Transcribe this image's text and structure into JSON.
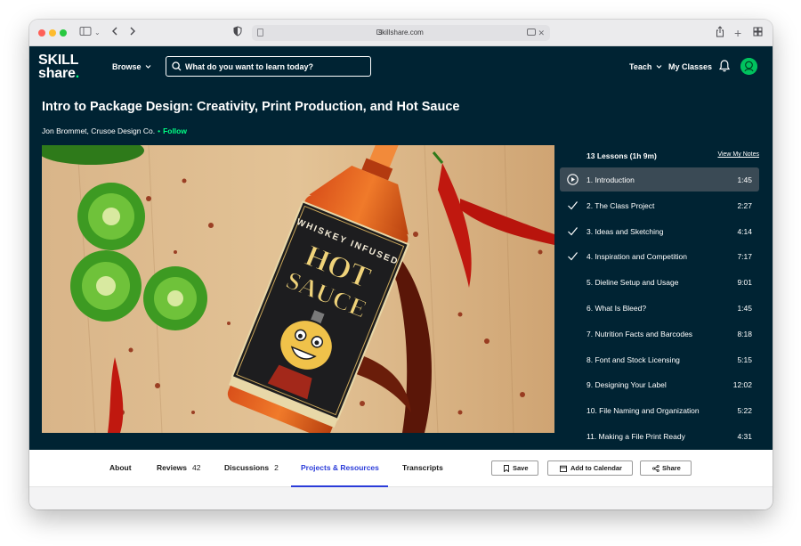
{
  "browser": {
    "url": "skillshare.com"
  },
  "header": {
    "logo_line1": "SKILL",
    "logo_line2": "share",
    "logo_dot": ".",
    "browse_label": "Browse",
    "search_placeholder": "What do you want to learn today?",
    "teach_label": "Teach",
    "my_classes_label": "My Classes"
  },
  "course": {
    "title": "Intro to Package Design: Creativity, Print Production, and Hot Sauce",
    "author": "Jon Brommet, Crusoe Design Co.",
    "separator": "•",
    "follow_label": "Follow"
  },
  "video": {
    "label_line1": "WHISKEY INFUSED",
    "label_hot": "HOT",
    "label_sauce": "SAUCE"
  },
  "playlist": {
    "header": "13 Lessons (1h 9m)",
    "notes_link": "View My Notes",
    "lessons": [
      {
        "label": "1. Introduction",
        "duration": "1:45",
        "state": "playing"
      },
      {
        "label": "2. The Class Project",
        "duration": "2:27",
        "state": "done"
      },
      {
        "label": "3. Ideas and Sketching",
        "duration": "4:14",
        "state": "done"
      },
      {
        "label": "4. Inspiration and Competition",
        "duration": "7:17",
        "state": "done"
      },
      {
        "label": "5. Dieline Setup and Usage",
        "duration": "9:01",
        "state": "none"
      },
      {
        "label": "6. What Is Bleed?",
        "duration": "1:45",
        "state": "none"
      },
      {
        "label": "7. Nutrition Facts and Barcodes",
        "duration": "8:18",
        "state": "none"
      },
      {
        "label": "8. Font and Stock Licensing",
        "duration": "5:15",
        "state": "none"
      },
      {
        "label": "9. Designing Your Label",
        "duration": "12:02",
        "state": "none"
      },
      {
        "label": "10. File Naming and Organization",
        "duration": "5:22",
        "state": "none"
      },
      {
        "label": "11. Making a File Print Ready",
        "duration": "4:31",
        "state": "none"
      }
    ]
  },
  "tabs": [
    {
      "label": "About",
      "count": ""
    },
    {
      "label": "Reviews",
      "count": "42"
    },
    {
      "label": "Discussions",
      "count": "2"
    },
    {
      "label": "Projects & Resources",
      "count": ""
    },
    {
      "label": "Transcripts",
      "count": ""
    }
  ],
  "actions": {
    "save_label": "Save",
    "calendar_label": "Add to Calendar",
    "share_label": "Share"
  },
  "colors": {
    "brand_green": "#00ff84",
    "header_bg": "#002333",
    "active_tab": "#2b3cd9"
  }
}
